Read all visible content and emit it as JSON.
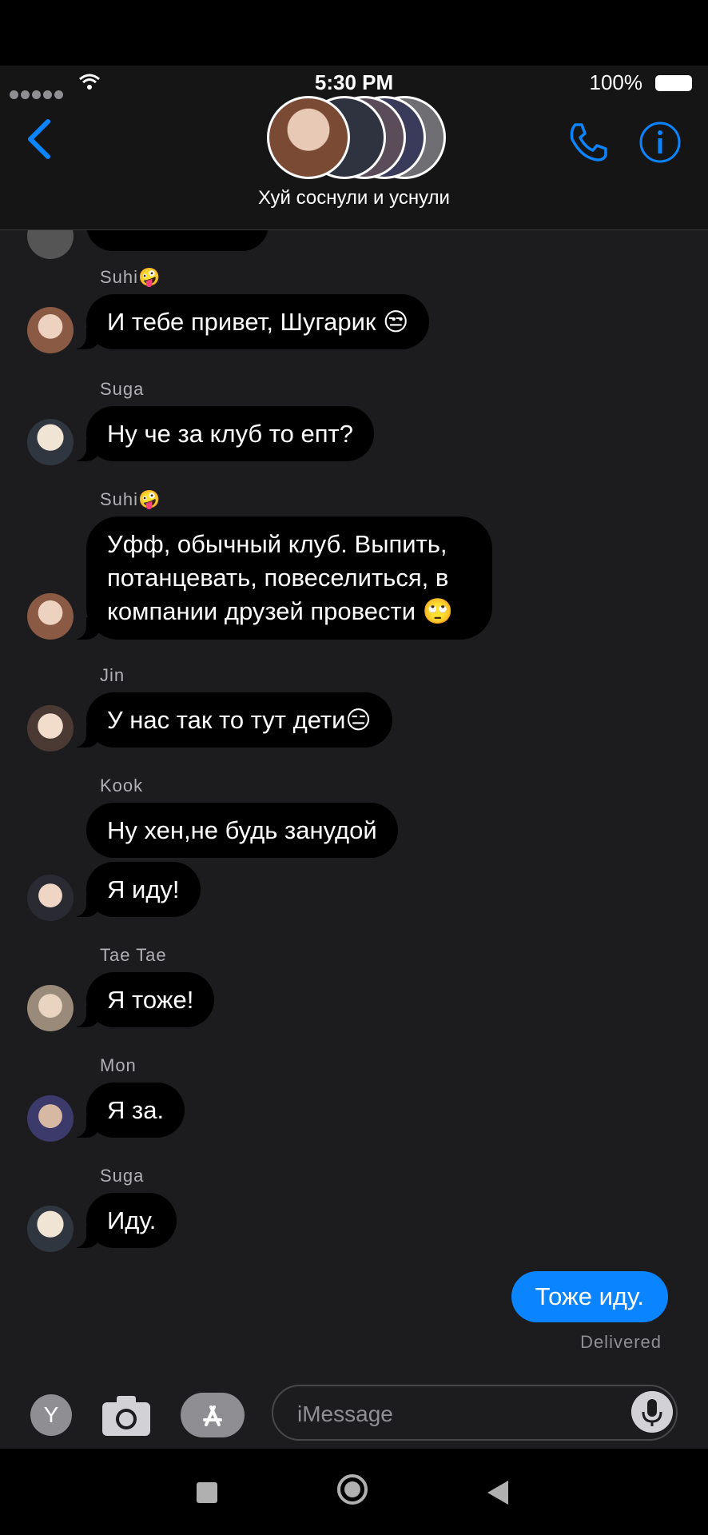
{
  "status": {
    "time": "5:30 PM",
    "battery": "100%"
  },
  "conversation": {
    "title": "Хуй соснули и уснули"
  },
  "messages": [
    {
      "sender": "Suhi🤪",
      "text": "И тебе привет, Шугарик 😒"
    },
    {
      "sender": "Suga",
      "text": "Ну че за клуб то епт?"
    },
    {
      "sender": "Suhi🤪",
      "text": "Уфф, обычный клуб. Выпить, потанцевать, повеселиться, в компании друзей провести 🙄"
    },
    {
      "sender": "Jin",
      "text": "У нас так то тут дети😑"
    },
    {
      "sender": "Kook",
      "text": "Ну хен,не будь занудой"
    },
    {
      "sender": "",
      "text": "Я иду!"
    },
    {
      "sender": "Tae Tae",
      "text": "Я тоже!"
    },
    {
      "sender": "Mon",
      "text": "Я за."
    },
    {
      "sender": "Suga",
      "text": "Иду."
    }
  ],
  "outgoing": {
    "text": "Тоже иду.",
    "status": "Delivered"
  },
  "composer": {
    "placeholder": "iMessage",
    "avatar_letter": "Y"
  },
  "colors": {
    "accent": "#0a84ff",
    "background": "#1c1c1e",
    "bubble": "#000000"
  }
}
